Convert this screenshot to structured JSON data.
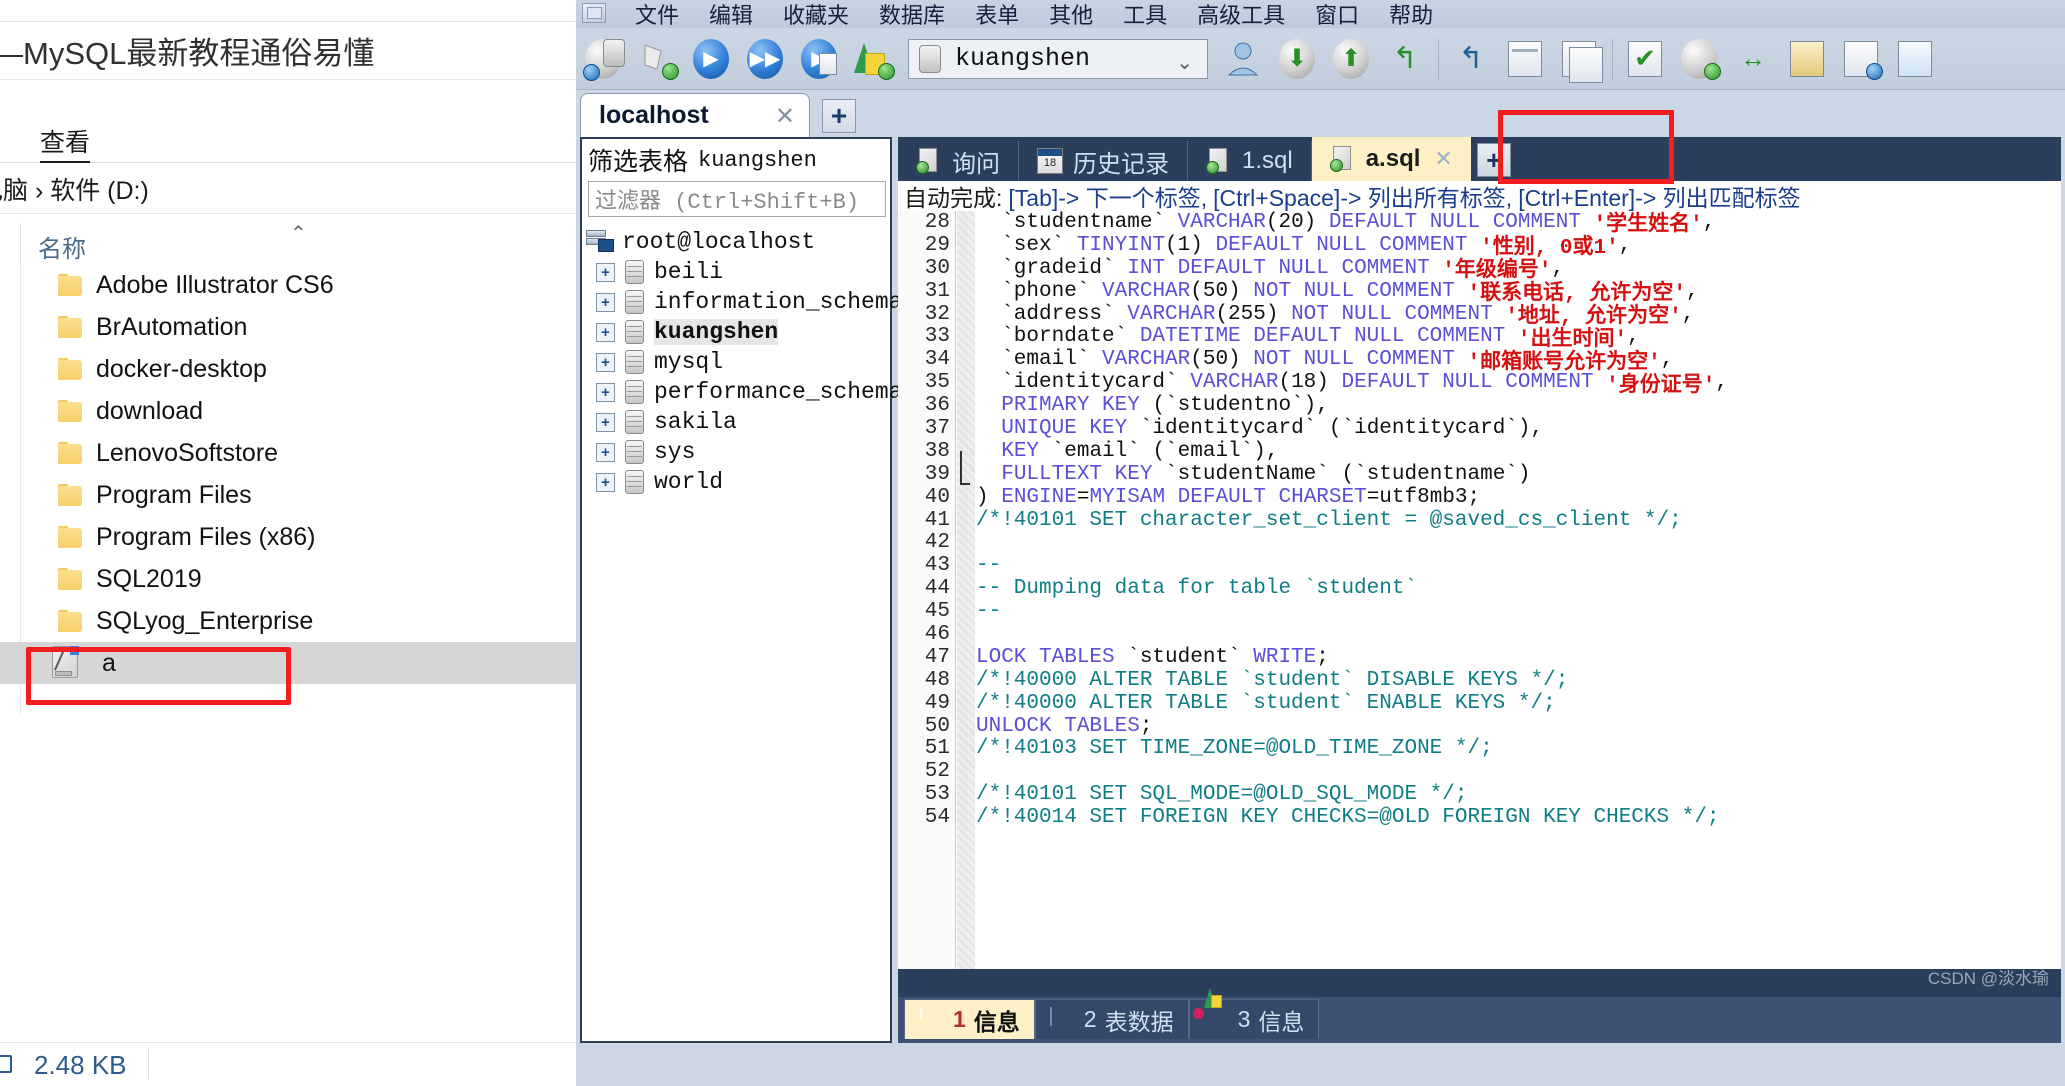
{
  "explorer": {
    "window_title": "—MySQL最新教程通俗易懂",
    "ribbon_tab": "查看",
    "breadcrumb": "电脑 › 软件 (D:)",
    "column_header": "名称",
    "items": [
      {
        "label": "Adobe Illustrator CS6",
        "type": "folder",
        "selected": false
      },
      {
        "label": "BrAutomation",
        "type": "folder",
        "selected": false
      },
      {
        "label": "docker-desktop",
        "type": "folder",
        "selected": false
      },
      {
        "label": "download",
        "type": "folder",
        "selected": false
      },
      {
        "label": "LenovoSoftstore",
        "type": "folder",
        "selected": false
      },
      {
        "label": "Program Files",
        "type": "folder",
        "selected": false
      },
      {
        "label": "Program Files (x86)",
        "type": "folder",
        "selected": false
      },
      {
        "label": "SQL2019",
        "type": "folder",
        "selected": false
      },
      {
        "label": "SQLyog_Enterprise",
        "type": "folder",
        "selected": false
      },
      {
        "label": "a",
        "type": "sql-file",
        "selected": true
      }
    ],
    "status_size": "2.48 KB"
  },
  "sqlyog": {
    "menu": [
      "文件",
      "编辑",
      "收藏夹",
      "数据库",
      "表单",
      "其他",
      "工具",
      "高级工具",
      "窗口",
      "帮助"
    ],
    "toolbar": {
      "database_selected": "kuangshen",
      "icons": [
        "new-connection-icon",
        "add-database-icon",
        "execute-query-icon",
        "execute-all-icon",
        "execute-current-icon",
        "refresh-objects-icon"
      ],
      "icons_right": [
        "user-manager-icon",
        "import-data-icon",
        "export-data-icon",
        "restore-icon",
        "backup-icon",
        "table-data-icon",
        "copy-table-icon",
        "check-table-icon",
        "sync-database-icon",
        "schema-sync-icon",
        "data-sync-icon",
        "scheduled-backup-icon",
        "notify-icon"
      ]
    },
    "connection_tab": {
      "label": "localhost",
      "close": "✕",
      "add": "+"
    },
    "object_panel": {
      "title": "筛选表格",
      "title_db": "kuangshen",
      "filter_placeholder": "过滤器 (Ctrl+Shift+B)",
      "root": "root@localhost",
      "databases": [
        {
          "name": "beili",
          "selected": false
        },
        {
          "name": "information_schema",
          "selected": false
        },
        {
          "name": "kuangshen",
          "selected": true
        },
        {
          "name": "mysql",
          "selected": false
        },
        {
          "name": "performance_schema",
          "selected": false
        },
        {
          "name": "sakila",
          "selected": false
        },
        {
          "name": "sys",
          "selected": false
        },
        {
          "name": "world",
          "selected": false
        }
      ]
    },
    "editor_tabs": [
      {
        "label": "询问",
        "icon": "query-icon",
        "active": false,
        "closable": false
      },
      {
        "label": "历史记录",
        "icon": "calendar-icon",
        "active": false,
        "closable": false
      },
      {
        "label": "1.sql",
        "icon": "sql-file-icon",
        "active": false,
        "closable": false
      },
      {
        "label": "a.sql",
        "icon": "sql-file-icon",
        "active": true,
        "closable": true
      }
    ],
    "editor_tab_add": "+",
    "hint": {
      "prefix": "自动完成:",
      "p1": "[Tab]-> 下一个标签,",
      "p2": "[Ctrl+Space]-> 列出所有标签,",
      "p3": "[Ctrl+Enter]-> 列出匹配标签"
    },
    "code_lines": [
      {
        "no": "28",
        "segments": [
          {
            "t": "  `studentname` ",
            "c": "d"
          },
          {
            "t": "VARCHAR",
            "c": "k"
          },
          {
            "t": "(20) ",
            "c": "d"
          },
          {
            "t": "DEFAULT NULL COMMENT ",
            "c": "k"
          },
          {
            "t": "'学生姓名'",
            "c": "s"
          },
          {
            "t": ",",
            "c": "d"
          }
        ]
      },
      {
        "no": "29",
        "segments": [
          {
            "t": "  `sex` ",
            "c": "d"
          },
          {
            "t": "TINYINT",
            "c": "k"
          },
          {
            "t": "(1) ",
            "c": "d"
          },
          {
            "t": "DEFAULT NULL COMMENT ",
            "c": "k"
          },
          {
            "t": "'性别, 0或1'",
            "c": "s"
          },
          {
            "t": ",",
            "c": "d"
          }
        ]
      },
      {
        "no": "30",
        "segments": [
          {
            "t": "  `gradeid` ",
            "c": "d"
          },
          {
            "t": "INT DEFAULT NULL COMMENT ",
            "c": "k"
          },
          {
            "t": "'年级编号'",
            "c": "s"
          },
          {
            "t": ",",
            "c": "d"
          }
        ]
      },
      {
        "no": "31",
        "segments": [
          {
            "t": "  `phone` ",
            "c": "d"
          },
          {
            "t": "VARCHAR",
            "c": "k"
          },
          {
            "t": "(50) ",
            "c": "d"
          },
          {
            "t": "NOT NULL COMMENT ",
            "c": "k"
          },
          {
            "t": "'联系电话, 允许为空'",
            "c": "s"
          },
          {
            "t": ",",
            "c": "d"
          }
        ]
      },
      {
        "no": "32",
        "segments": [
          {
            "t": "  `address` ",
            "c": "d"
          },
          {
            "t": "VARCHAR",
            "c": "k"
          },
          {
            "t": "(255) ",
            "c": "d"
          },
          {
            "t": "NOT NULL COMMENT ",
            "c": "k"
          },
          {
            "t": "'地址, 允许为空'",
            "c": "s"
          },
          {
            "t": ",",
            "c": "d"
          }
        ]
      },
      {
        "no": "33",
        "segments": [
          {
            "t": "  `borndate` ",
            "c": "d"
          },
          {
            "t": "DATETIME DEFAULT NULL COMMENT ",
            "c": "k"
          },
          {
            "t": "'出生时间'",
            "c": "s"
          },
          {
            "t": ",",
            "c": "d"
          }
        ]
      },
      {
        "no": "34",
        "segments": [
          {
            "t": "  `email` ",
            "c": "d"
          },
          {
            "t": "VARCHAR",
            "c": "k"
          },
          {
            "t": "(50) ",
            "c": "d"
          },
          {
            "t": "NOT NULL COMMENT ",
            "c": "k"
          },
          {
            "t": "'邮箱账号允许为空'",
            "c": "s"
          },
          {
            "t": ",",
            "c": "d"
          }
        ]
      },
      {
        "no": "35",
        "segments": [
          {
            "t": "  `identitycard` ",
            "c": "d"
          },
          {
            "t": "VARCHAR",
            "c": "k"
          },
          {
            "t": "(18) ",
            "c": "d"
          },
          {
            "t": "DEFAULT NULL COMMENT ",
            "c": "k"
          },
          {
            "t": "'身份证号'",
            "c": "s"
          },
          {
            "t": ",",
            "c": "d"
          }
        ]
      },
      {
        "no": "36",
        "segments": [
          {
            "t": "  ",
            "c": "d"
          },
          {
            "t": "PRIMARY KEY",
            "c": "k"
          },
          {
            "t": " (`studentno`),",
            "c": "d"
          }
        ]
      },
      {
        "no": "37",
        "segments": [
          {
            "t": "  ",
            "c": "d"
          },
          {
            "t": "UNIQUE KEY",
            "c": "k"
          },
          {
            "t": " `identitycard` (`identitycard`),",
            "c": "d"
          }
        ]
      },
      {
        "no": "38",
        "segments": [
          {
            "t": "  ",
            "c": "d"
          },
          {
            "t": "KEY",
            "c": "k"
          },
          {
            "t": " `email` (`email`),",
            "c": "d"
          }
        ]
      },
      {
        "no": "39",
        "segments": [
          {
            "t": "  ",
            "c": "d"
          },
          {
            "t": "FULLTEXT KEY",
            "c": "k"
          },
          {
            "t": " `studentName` (`studentname`)",
            "c": "d"
          }
        ]
      },
      {
        "no": "40",
        "segments": [
          {
            "t": ") ",
            "c": "d"
          },
          {
            "t": "ENGINE",
            "c": "k"
          },
          {
            "t": "=",
            "c": "d"
          },
          {
            "t": "MYISAM DEFAULT CHARSET",
            "c": "k"
          },
          {
            "t": "=utf8mb3;",
            "c": "d"
          }
        ]
      },
      {
        "no": "41",
        "segments": [
          {
            "t": "/*!40101 SET character_set_client = @saved_cs_client */;",
            "c": "kg"
          }
        ]
      },
      {
        "no": "42",
        "segments": [
          {
            "t": "",
            "c": "d"
          }
        ]
      },
      {
        "no": "43",
        "segments": [
          {
            "t": "--",
            "c": "kg"
          }
        ]
      },
      {
        "no": "44",
        "segments": [
          {
            "t": "-- Dumping data for table `student`",
            "c": "kg"
          }
        ]
      },
      {
        "no": "45",
        "segments": [
          {
            "t": "--",
            "c": "kg"
          }
        ]
      },
      {
        "no": "46",
        "segments": [
          {
            "t": "",
            "c": "d"
          }
        ]
      },
      {
        "no": "47",
        "segments": [
          {
            "t": "LOCK TABLES",
            "c": "k"
          },
          {
            "t": " `student` ",
            "c": "d"
          },
          {
            "t": "WRITE",
            "c": "k"
          },
          {
            "t": ";",
            "c": "d"
          }
        ]
      },
      {
        "no": "48",
        "segments": [
          {
            "t": "/*!40000 ALTER TABLE `student` DISABLE KEYS */;",
            "c": "kg"
          }
        ]
      },
      {
        "no": "49",
        "segments": [
          {
            "t": "/*!40000 ALTER TABLE `student` ENABLE KEYS */;",
            "c": "kg"
          }
        ]
      },
      {
        "no": "50",
        "segments": [
          {
            "t": "UNLOCK TABLES",
            "c": "k"
          },
          {
            "t": ";",
            "c": "d"
          }
        ]
      },
      {
        "no": "51",
        "segments": [
          {
            "t": "/*!40103 SET TIME_ZONE=@OLD_TIME_ZONE */;",
            "c": "kg"
          }
        ]
      },
      {
        "no": "52",
        "segments": [
          {
            "t": "",
            "c": "d"
          }
        ]
      },
      {
        "no": "53",
        "segments": [
          {
            "t": "/*!40101 SET SQL_MODE=@OLD_SQL_MODE */;",
            "c": "kg"
          }
        ]
      },
      {
        "no": "54",
        "segments": [
          {
            "t": "/*!40014 SET FOREIGN KEY CHECKS=@OLD FOREIGN KEY CHECKS */;",
            "c": "kg"
          }
        ]
      }
    ],
    "bottom_tabs": [
      {
        "num": "1",
        "label": "信息",
        "icon": "info-icon",
        "active": true
      },
      {
        "num": "2",
        "label": "表数据",
        "icon": "grid-icon",
        "active": false
      },
      {
        "num": "3",
        "label": "信息",
        "icon": "chart-icon",
        "active": false
      }
    ],
    "watermark": "CSDN @淡水瑜"
  },
  "colors": {
    "accent_red": "#f21d1d",
    "tab_active_bg": "#fdf0c7",
    "editor_chrome": "#2b3e5c",
    "keyword": "#5b4fd6",
    "comment": "#0f7d85",
    "string": "#d41010"
  }
}
